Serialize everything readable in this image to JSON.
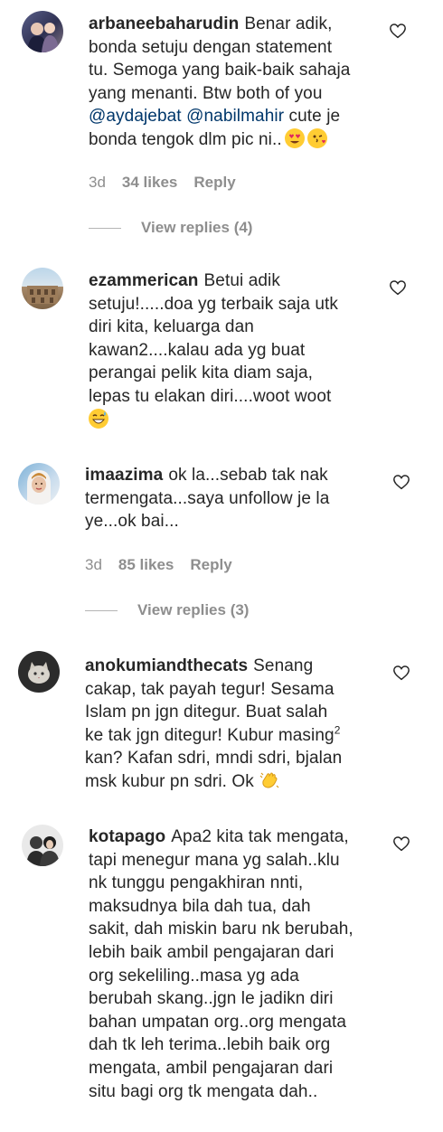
{
  "comments": [
    {
      "username": "arbaneebaharudin",
      "lines": [
        "Benar adik,",
        "bonda setuju dengan statement",
        "tu. Semoga yang baik-baik sahaja",
        "yang menanti. Btw both of you",
        "",
        "bonda tengok dlm pic ni.."
      ],
      "mentions": [
        "@aydajebat",
        "@nabilmahir"
      ],
      "mention_suffix": "cute je",
      "time": "3d",
      "likes": "34 likes",
      "reply": "Reply",
      "view_replies": "View replies (4)",
      "emojis": [
        "heart-eyes-emoji",
        "kissing-face-emoji"
      ]
    },
    {
      "username": "ezammerican",
      "lines": [
        "Betui adik",
        "setuju!.....doa yg terbaik saja utk",
        "diri kita, keluarga dan",
        "kawan2....kalau ada yg buat",
        "perangai pelik kita diam saja,",
        "lepas tu elakan diri....woot woot"
      ],
      "emojis": [
        "grinning-sweat-emoji"
      ]
    },
    {
      "username": "imaazima",
      "lines": [
        "ok la...sebab tak nak",
        "termengata...saya unfollow je la",
        "ye...ok bai..."
      ],
      "time": "3d",
      "likes": "85 likes",
      "reply": "Reply",
      "view_replies": "View replies (3)"
    },
    {
      "username": "anokumiandthecats",
      "lines": [
        "Senang",
        "cakap, tak payah tegur! Sesama",
        "Islam pn jgn ditegur. Buat salah",
        "ke tak jgn ditegur! Kubur masing",
        "kan? Kafan sdri, mndi sdri, bjalan",
        "msk kubur pn sdri. Ok"
      ],
      "superscript": "2",
      "emojis": [
        "clapping-hands-emoji"
      ]
    },
    {
      "username": "kotapago",
      "lines": [
        "Apa2 kita tak mengata,",
        "tapi menegur mana yg salah..klu",
        "nk tunggu pengakhiran nnti,",
        "maksudnya bila dah tua, dah",
        "sakit, dah miskin baru nk berubah,",
        "lebih baik ambil pengajaran dari",
        "org sekeliling..masa yg ada",
        "berubah skang..jgn le jadikn diri",
        "bahan umpatan org..org mengata",
        "dah tk leh terima..lebih baik org",
        "mengata, ambil pengajaran dari",
        "situ bagi org tk mengata dah.."
      ]
    }
  ],
  "colors": {
    "text": "#262626",
    "muted": "#8e8e8e",
    "mention": "#00376b",
    "emoji_yellow": "#ffcc33"
  }
}
